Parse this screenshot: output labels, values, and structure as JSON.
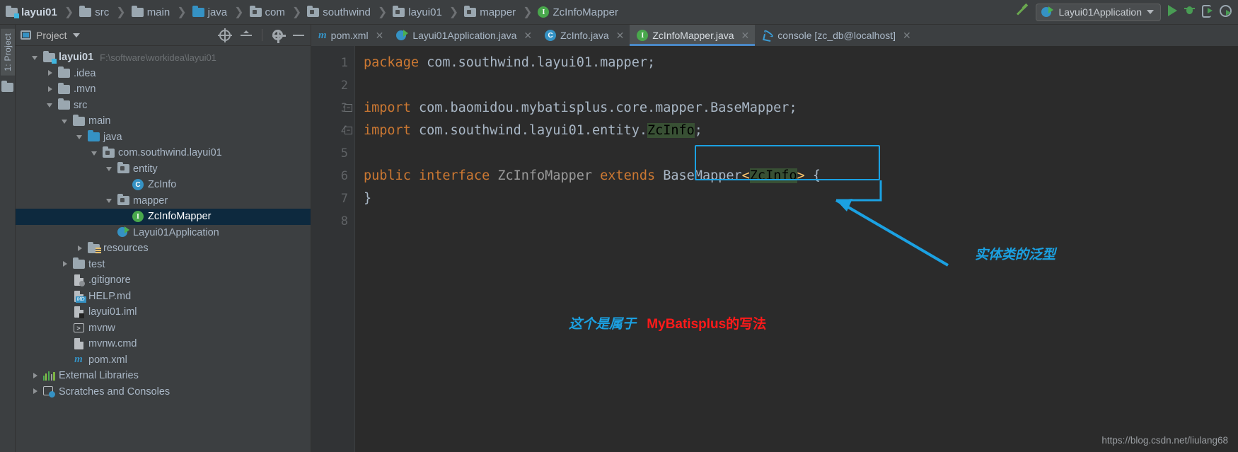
{
  "breadcrumb": [
    {
      "label": "layui01",
      "icon": "module-folder-icon",
      "bold": true
    },
    {
      "label": "src",
      "icon": "folder-icon"
    },
    {
      "label": "main",
      "icon": "folder-icon"
    },
    {
      "label": "java",
      "icon": "source-folder-icon"
    },
    {
      "label": "com",
      "icon": "package-icon"
    },
    {
      "label": "southwind",
      "icon": "package-icon"
    },
    {
      "label": "layui01",
      "icon": "package-icon"
    },
    {
      "label": "mapper",
      "icon": "package-icon"
    },
    {
      "label": "ZcInfoMapper",
      "icon": "interface-icon"
    }
  ],
  "toolbar": {
    "build_icon": "hammer-icon",
    "run_config": "Layui01Application",
    "run_config_icon": "spring-boot-icon",
    "dropdown_icon": "chevron-down-icon",
    "run_icon": "run-icon",
    "debug_icon": "debug-bug-icon",
    "rerun_icon": "run-with-profiler-icon",
    "coverage_icon": "run-with-coverage-icon"
  },
  "tool_window": {
    "vertical_tab": "1: Project",
    "folder_icon": "folder-icon"
  },
  "project_panel": {
    "title": "Project",
    "title_icon": "project-view-icon",
    "dropdown_icon": "chevron-down-icon",
    "locate_icon": "scroll-from-source-icon",
    "collapse_icon": "collapse-all-icon",
    "settings_icon": "gear-icon",
    "hide_icon": "hide-icon",
    "tree": [
      {
        "label": "layui01",
        "path": "F:\\software\\workidea\\layui01",
        "indent": 0,
        "arrow": "open",
        "icon": "module-folder-icon",
        "bold": true
      },
      {
        "label": ".idea",
        "path": "",
        "indent": 1,
        "arrow": "closed",
        "icon": "folder-icon"
      },
      {
        "label": ".mvn",
        "path": "",
        "indent": 1,
        "arrow": "closed",
        "icon": "folder-icon"
      },
      {
        "label": "src",
        "path": "",
        "indent": 1,
        "arrow": "open",
        "icon": "folder-icon"
      },
      {
        "label": "main",
        "path": "",
        "indent": 2,
        "arrow": "open",
        "icon": "folder-icon"
      },
      {
        "label": "java",
        "path": "",
        "indent": 3,
        "arrow": "open",
        "icon": "source-folder-icon"
      },
      {
        "label": "com.southwind.layui01",
        "path": "",
        "indent": 4,
        "arrow": "open",
        "icon": "package-icon"
      },
      {
        "label": "entity",
        "path": "",
        "indent": 5,
        "arrow": "open",
        "icon": "package-icon"
      },
      {
        "label": "ZcInfo",
        "path": "",
        "indent": 6,
        "arrow": "none",
        "icon": "class-icon"
      },
      {
        "label": "mapper",
        "path": "",
        "indent": 5,
        "arrow": "open",
        "icon": "package-icon"
      },
      {
        "label": "ZcInfoMapper",
        "path": "",
        "indent": 6,
        "arrow": "none",
        "icon": "interface-icon",
        "selected": true
      },
      {
        "label": "Layui01Application",
        "path": "",
        "indent": 5,
        "arrow": "none",
        "icon": "spring-boot-class-icon"
      },
      {
        "label": "resources",
        "path": "",
        "indent": 3,
        "arrow": "closed",
        "icon": "resources-folder-icon"
      },
      {
        "label": "test",
        "path": "",
        "indent": 2,
        "arrow": "closed",
        "icon": "folder-icon"
      },
      {
        "label": ".gitignore",
        "path": "",
        "indent": 2,
        "arrow": "none",
        "icon": "gitignore-file-icon"
      },
      {
        "label": "HELP.md",
        "path": "",
        "indent": 2,
        "arrow": "none",
        "icon": "markdown-file-icon"
      },
      {
        "label": "layui01.iml",
        "path": "",
        "indent": 2,
        "arrow": "none",
        "icon": "iml-file-icon"
      },
      {
        "label": "mvnw",
        "path": "",
        "indent": 2,
        "arrow": "none",
        "icon": "shell-script-icon"
      },
      {
        "label": "mvnw.cmd",
        "path": "",
        "indent": 2,
        "arrow": "none",
        "icon": "cmd-file-icon"
      },
      {
        "label": "pom.xml",
        "path": "",
        "indent": 2,
        "arrow": "none",
        "icon": "maven-file-icon"
      },
      {
        "label": "External Libraries",
        "path": "",
        "indent": 0,
        "arrow": "closed",
        "icon": "libraries-icon"
      },
      {
        "label": "Scratches and Consoles",
        "path": "",
        "indent": 0,
        "arrow": "closed",
        "icon": "scratches-icon"
      }
    ]
  },
  "editor_tabs": [
    {
      "label": "pom.xml",
      "icon": "maven-file-icon",
      "active": false,
      "closable": true
    },
    {
      "label": "Layui01Application.java",
      "icon": "spring-boot-class-icon",
      "active": false,
      "closable": true
    },
    {
      "label": "ZcInfo.java",
      "icon": "class-icon",
      "active": false,
      "closable": true
    },
    {
      "label": "ZcInfoMapper.java",
      "icon": "interface-icon",
      "active": true,
      "closable": true
    },
    {
      "label": "console [zc_db@localhost]",
      "icon": "mysql-console-icon",
      "active": false,
      "closable": true
    }
  ],
  "editor": {
    "line_numbers": [
      "1",
      "2",
      "3",
      "4",
      "5",
      "6",
      "7",
      "8"
    ],
    "code_lines": [
      {
        "n": 1,
        "segments": [
          {
            "t": "package",
            "c": "kw"
          },
          {
            "t": " com.southwind.layui01.mapper;",
            "c": "plain"
          }
        ]
      },
      {
        "n": 2,
        "segments": []
      },
      {
        "n": 3,
        "fold": true,
        "segments": [
          {
            "t": "import",
            "c": "kw"
          },
          {
            "t": " com.baomidou.mybatisplus.core.mapper.BaseMapper;",
            "c": "plain"
          }
        ]
      },
      {
        "n": 4,
        "fold": true,
        "segments": [
          {
            "t": "import",
            "c": "kw"
          },
          {
            "t": " com.southwind.layui01.entity.",
            "c": "plain"
          },
          {
            "t": "ZcInfo",
            "c": "hl-green"
          },
          {
            "t": ";",
            "c": "plain"
          }
        ]
      },
      {
        "n": 5,
        "segments": []
      },
      {
        "n": 6,
        "segments": [
          {
            "t": "public",
            "c": "kw"
          },
          {
            "t": " ",
            "c": "plain"
          },
          {
            "t": "interface",
            "c": "kw"
          },
          {
            "t": " ",
            "c": "plain"
          },
          {
            "t": "ZcInfoMapper",
            "c": "ifacename"
          },
          {
            "t": " ",
            "c": "plain"
          },
          {
            "t": "extends",
            "c": "kw"
          },
          {
            "t": " BaseMapper",
            "c": "plain"
          },
          {
            "t": "<",
            "c": "angle"
          },
          {
            "t": "ZcInfo",
            "c": "hl-green"
          },
          {
            "t": ">",
            "c": "angle"
          },
          {
            "t": " {",
            "c": "plain"
          }
        ]
      },
      {
        "n": 7,
        "segments": [
          {
            "t": "}",
            "c": "plain"
          }
        ]
      },
      {
        "n": 8,
        "segments": []
      }
    ]
  },
  "annotations": {
    "generic_note": "实体类的泛型",
    "mybatis_note_blue": "这个是属于",
    "mybatis_note_red": "MyBatisplus的写法",
    "highlight_color": "#1ba1e2",
    "red_color": "#ff1a1a"
  },
  "watermark": "https://blog.csdn.net/liulang68"
}
